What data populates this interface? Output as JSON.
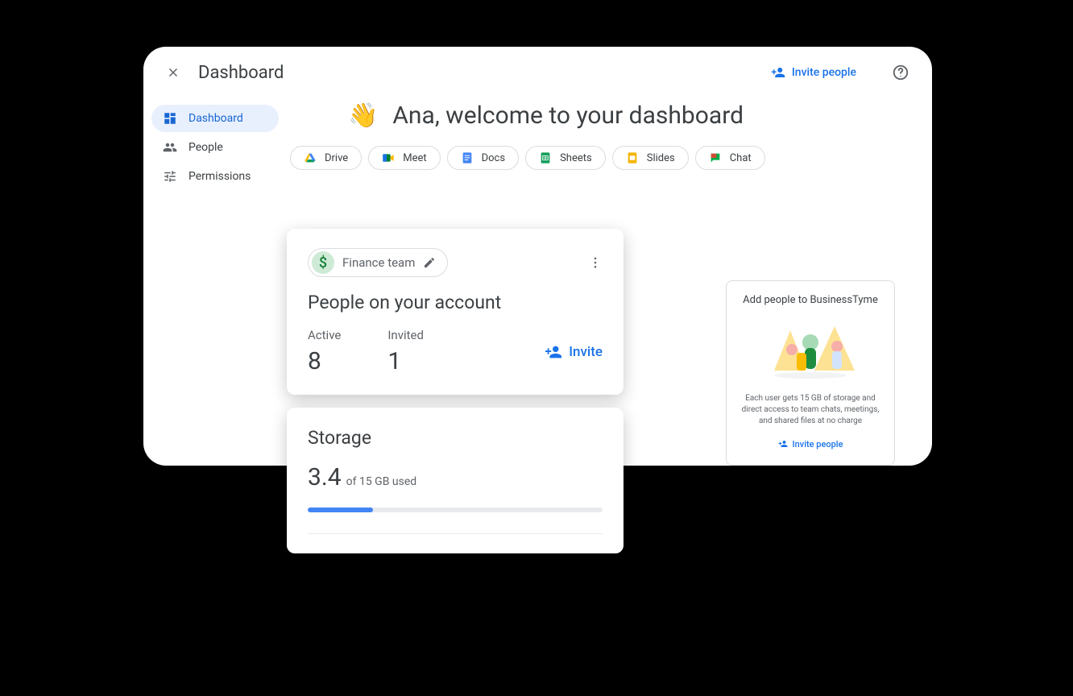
{
  "header": {
    "title": "Dashboard",
    "invite_label": "Invite people"
  },
  "sidebar": {
    "items": [
      {
        "label": "Dashboard"
      },
      {
        "label": "People"
      },
      {
        "label": "Permissions"
      }
    ]
  },
  "welcome": {
    "emoji": "👋",
    "text": "Ana, welcome to your dashboard"
  },
  "apps": [
    {
      "label": "Drive"
    },
    {
      "label": "Meet"
    },
    {
      "label": "Docs"
    },
    {
      "label": "Sheets"
    },
    {
      "label": "Slides"
    },
    {
      "label": "Chat"
    }
  ],
  "people_card": {
    "team_name": "Finance team",
    "team_symbol": "$",
    "title": "People on your account",
    "active_label": "Active",
    "active_count": "8",
    "invited_label": "Invited",
    "invited_count": "1",
    "invite_label": "Invite"
  },
  "storage_card": {
    "title": "Storage",
    "used_value": "3.4",
    "used_text": "of 15 GB used",
    "percent": 22
  },
  "promo": {
    "title": "Add people to BusinessTyme",
    "desc": "Each user gets 15 GB of storage and direct access to team chats, meetings, and shared files at no charge",
    "link": "Invite people"
  }
}
